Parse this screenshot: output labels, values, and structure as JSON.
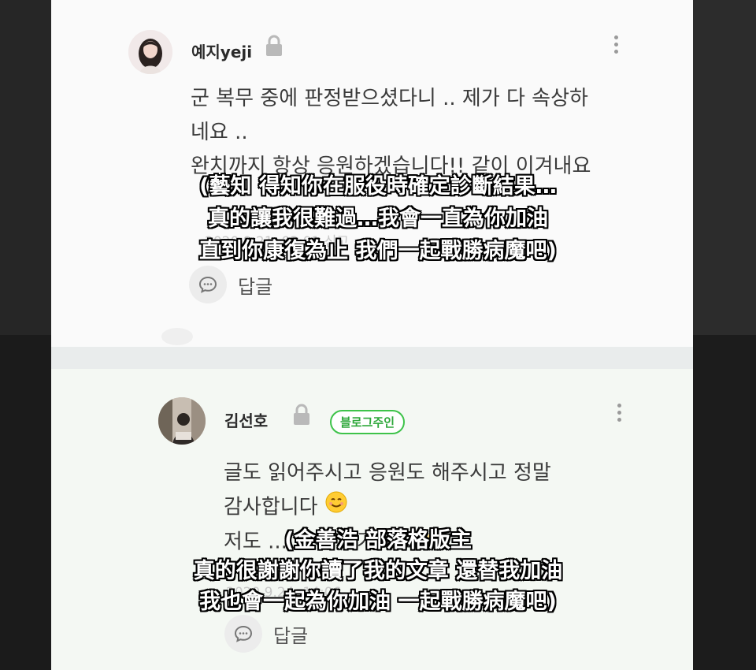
{
  "comment1": {
    "author": "예지yeji",
    "lines": [
      "군 복무 중에 판정받으셨다니 .. 제가 다 속상하",
      "네요 ..",
      "완치까지 항상 응원하겠습니다!! 같이 이겨내요"
    ],
    "date": "2020.9.21. 03:01   신고",
    "reply_label": "답글"
  },
  "comment2": {
    "author": "김선호",
    "badge": "블로그주인",
    "lines": [
      "글도 읽어주시고 응원도 해주시고 정말",
      "감사합니다",
      "저도 ... 같이 이겨내요"
    ],
    "date": "2020.9.24. 14:06",
    "reply_label": "답글"
  },
  "subtitles": {
    "block1": [
      "(藝知 得知你在服役時確定診斷結果…",
      "真的讓我很難過…我會一直為你加油",
      "直到你康復為止 我們一起戰勝病魔吧)"
    ],
    "block2": [
      "(金善浩 部落格版主",
      "真的很謝謝你讀了我的文章 還替我加油",
      "我也會一起為你加油 一起戰勝病魔吧)"
    ]
  },
  "icons": [
    "lock-icon",
    "more-vertical-icon",
    "reply-chat-icon",
    "smile-emoji-icon",
    "thumbs-up-emoji-icon"
  ],
  "colors": {
    "badge_green": "#3ec34a",
    "owner_bg": "#f4f8f3",
    "card_bg": "#fafafa"
  }
}
